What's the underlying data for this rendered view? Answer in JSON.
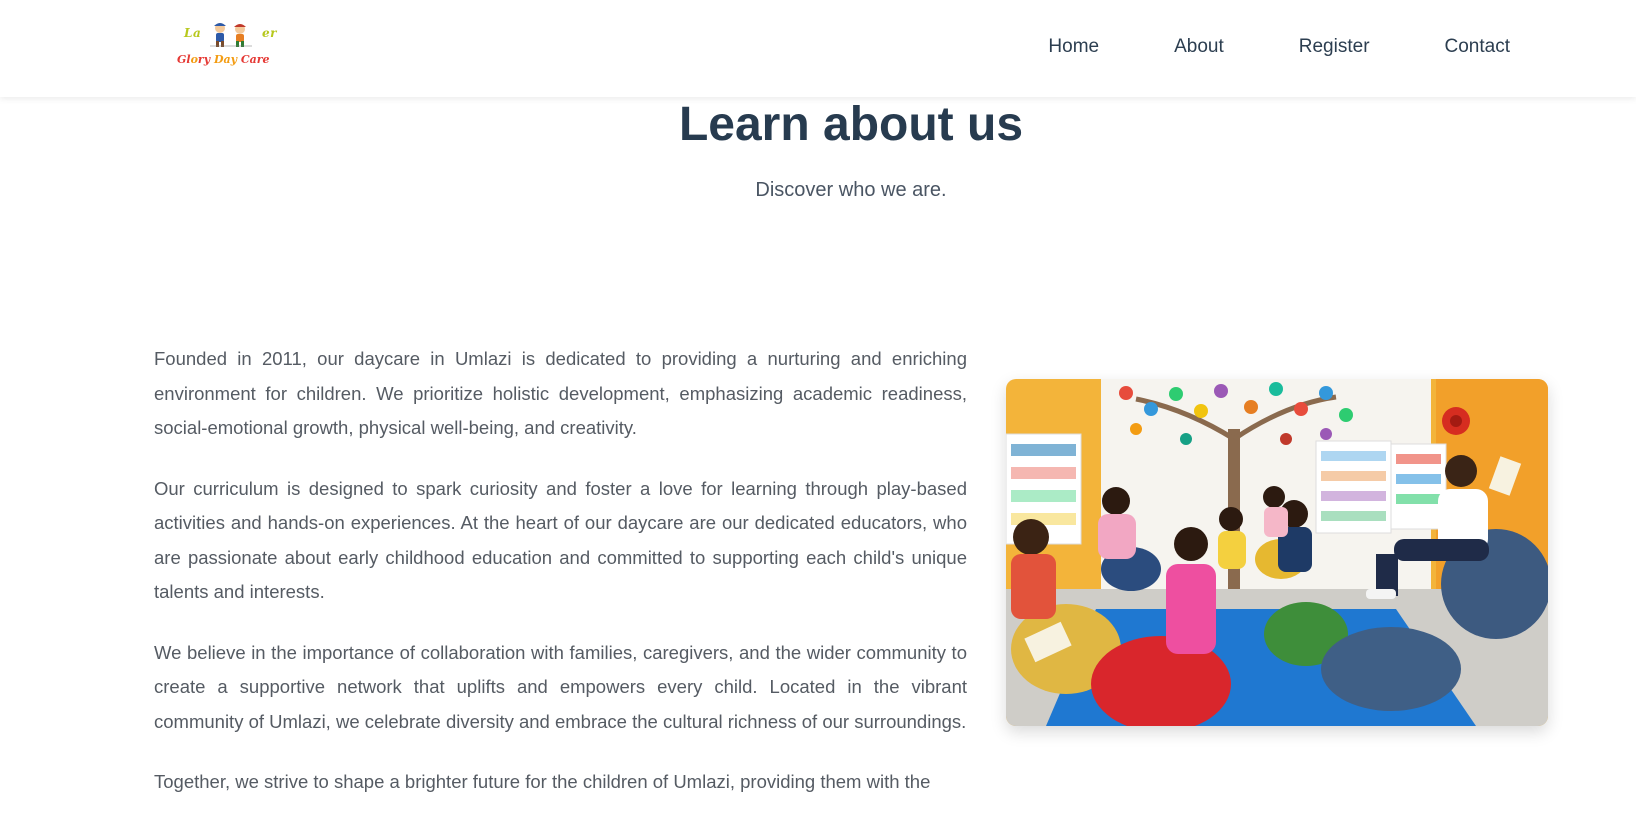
{
  "header": {
    "logo": {
      "text_top_left": "La",
      "text_top_right": "er",
      "text_bottom": [
        "Gl",
        "o",
        "ry ",
        "Day ",
        "Care"
      ]
    },
    "nav": [
      {
        "label": "Home"
      },
      {
        "label": "About"
      },
      {
        "label": "Register"
      },
      {
        "label": "Contact"
      }
    ]
  },
  "main": {
    "title": "Learn about us",
    "subtitle": "Discover who we are.",
    "paragraphs": [
      "Founded in 2011, our daycare in Umlazi is dedicated to providing a nurturing and enriching environment for children. We prioritize holistic development, emphasizing academic readiness, social-emotional growth, physical well-being, and creativity.",
      "Our curriculum is designed to spark curiosity and foster a love for learning through play-based activities and hands-on experiences. At the heart of our daycare are our dedicated educators, who are passionate about early childhood education and committed to supporting each child's unique talents and interests.",
      "We believe in the importance of collaboration with families, caregivers, and the wider community to create a supportive network that uplifts and empowers every child. Located in the vibrant community of Umlazi, we celebrate diversity and embrace the cultural richness of our surroundings.",
      "Together, we strive to shape a brighter future for the children of Umlazi, providing them with the"
    ]
  },
  "colors": {
    "heading": "#273b4f",
    "nav_text": "#2c3e50",
    "body_text": "#555b63",
    "logo_green": "#b7c81d",
    "logo_red": "#e53935",
    "logo_orange": "#f39c12"
  }
}
